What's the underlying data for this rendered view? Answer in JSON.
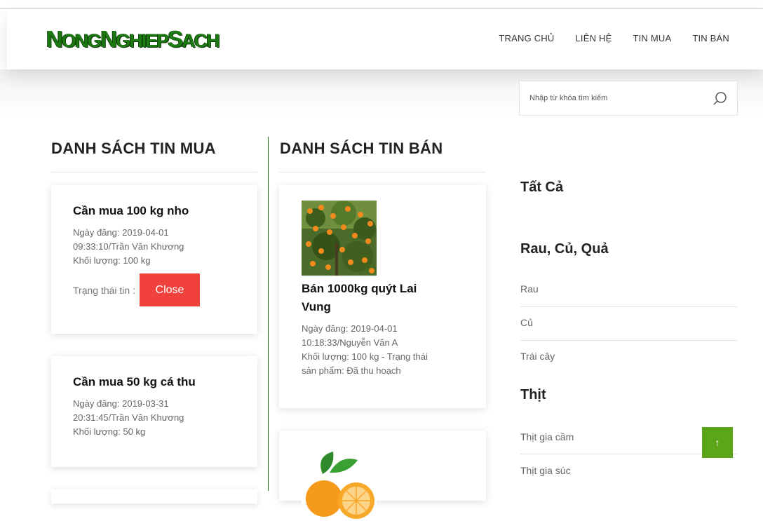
{
  "header": {
    "logo_big1": "N",
    "logo_small1": "ONG",
    "logo_big2": "N",
    "logo_small2": "GHIEP",
    "logo_big3": "S",
    "logo_small3": "ACH",
    "nav": [
      "TRANG CHỦ",
      "LIÊN HỆ",
      "TIN MUA",
      "TIN BÁN"
    ]
  },
  "search": {
    "placeholder": "Nhập từ khóa tìm kiếm"
  },
  "buy_column": {
    "title": "DANH SÁCH TIN MUA",
    "items": [
      {
        "title": "Cần mua 100 kg nho",
        "date_line1": "Ngày đăng: 2019-04-01",
        "date_line2": "09:33:10/Trần Văn Khương",
        "weight": "Khối lượng: 100 kg",
        "status_label": "Trạng thái tin :",
        "status_button": "Close"
      },
      {
        "title": "Cần mua 50 kg cá thu",
        "date_line1": "Ngày đăng: 2019-03-31",
        "date_line2": "20:31:45/Trần Văn Khương",
        "weight": "Khối lượng: 50 kg"
      }
    ]
  },
  "sell_column": {
    "title": "DANH SÁCH TIN BÁN",
    "items": [
      {
        "image": "tangerine-tree-photo",
        "title_line1": "Bán 1000kg quýt Lai",
        "title_line2": "Vung",
        "date_line1": "Ngày đăng: 2019-04-01",
        "date_line2": "10:18:33/Nguyễn Văn A",
        "info_line1": "Khối lượng: 100 kg - Trạng thái",
        "info_line2": "sản phẩm: Đã thu hoạch"
      },
      {
        "image": "orange-photo"
      }
    ]
  },
  "sidebar": {
    "all": "Tất Cả",
    "group1": {
      "title": "Rau, Củ, Quả",
      "links": [
        "Rau",
        "Củ",
        "Trái cây"
      ]
    },
    "group2": {
      "title": "Thịt",
      "links": [
        "Thịt gia cầm",
        "Thịt gia súc"
      ]
    }
  },
  "back_to_top": "↑",
  "colors": {
    "brand_green": "#1d7a12",
    "close_red": "#f0413d",
    "to_top_green": "#5aa51a"
  }
}
